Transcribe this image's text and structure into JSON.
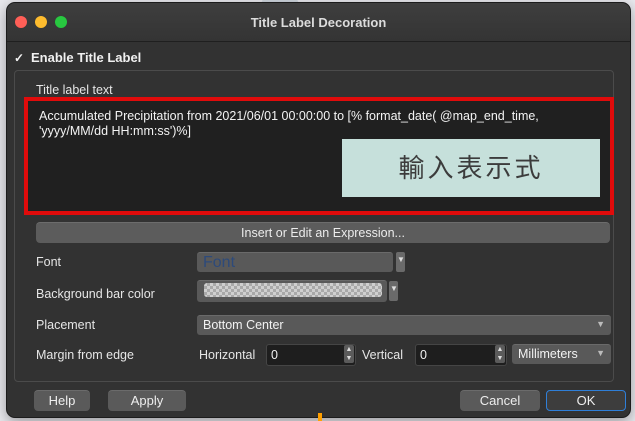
{
  "window": {
    "title": "Title Label Decoration"
  },
  "enable_title": {
    "label": "Enable Title Label",
    "checked": true,
    "check_glyph": "✓"
  },
  "title_text": {
    "label": "Title label text",
    "value": "Accumulated Precipitation from 2021/06/01 00:00:00 to [% format_date( @map_end_time,\n'yyyy/MM/dd HH:mm:ss')%]",
    "callout": "輸入表示式",
    "highlight_color": "#e00b0b"
  },
  "insert_expression_button": "Insert or Edit an Expression...",
  "font": {
    "label": "Font",
    "value": "Font"
  },
  "background_bar": {
    "label": "Background bar color"
  },
  "placement": {
    "label": "Placement",
    "value": "Bottom Center"
  },
  "margin": {
    "label": "Margin from edge",
    "horizontal_label": "Horizontal",
    "horizontal_value": "0",
    "vertical_label": "Vertical",
    "vertical_value": "0",
    "unit": "Millimeters"
  },
  "footer": {
    "help": "Help",
    "apply": "Apply",
    "cancel": "Cancel",
    "ok": "OK"
  },
  "icons": {
    "dropdown": "chevron-down-icon",
    "stepper": "spin-stepper-icon"
  }
}
